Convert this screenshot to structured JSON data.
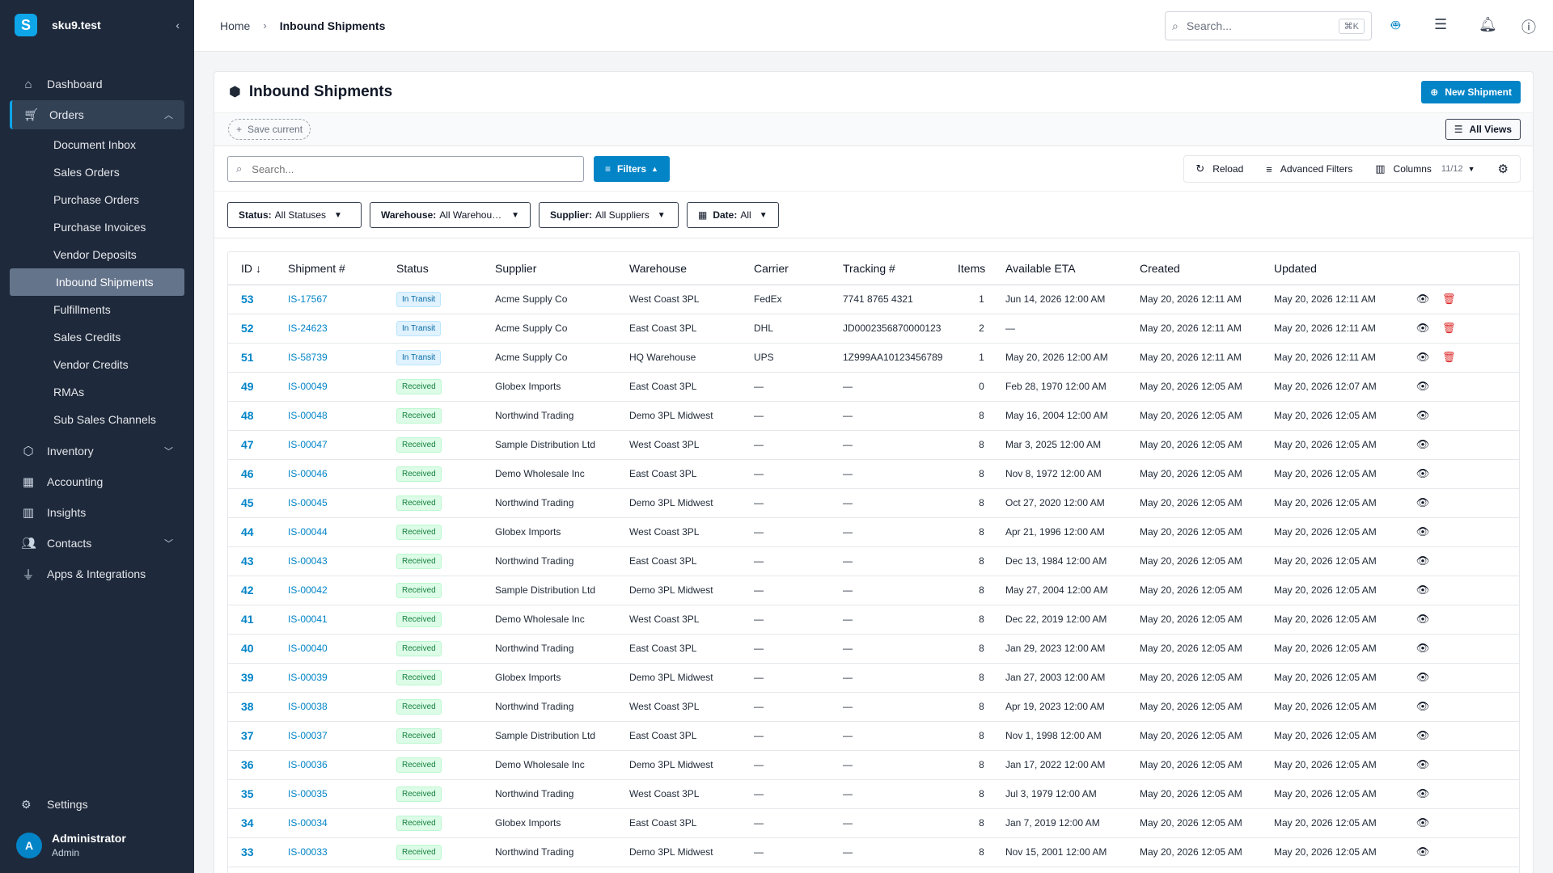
{
  "app": {
    "name": "sku9.test",
    "logo_letter": "S",
    "accent": "#0284c7"
  },
  "sidebar": {
    "items": [
      {
        "key": "dashboard",
        "label": "Dashboard",
        "icon": "home-icon"
      },
      {
        "key": "orders",
        "label": "Orders",
        "icon": "cart-icon",
        "expanded": true,
        "children": [
          "Document Inbox",
          "Sales Orders",
          "Purchase Orders",
          "Purchase Invoices",
          "Vendor Deposits",
          "Inbound Shipments",
          "Fulfillments",
          "Sales Credits",
          "Vendor Credits",
          "RMAs",
          "Sub Sales Channels"
        ]
      },
      {
        "key": "inventory",
        "label": "Inventory",
        "icon": "box-icon",
        "has_children": true
      },
      {
        "key": "accounting",
        "label": "Accounting",
        "icon": "calculator-icon"
      },
      {
        "key": "insights",
        "label": "Insights",
        "icon": "bar-chart-icon"
      },
      {
        "key": "contacts",
        "label": "Contacts",
        "icon": "users-icon",
        "has_children": true
      },
      {
        "key": "apps",
        "label": "Apps & Integrations",
        "icon": "plug-icon"
      }
    ],
    "active_child": "Inbound Shipments",
    "settings_label": "Settings",
    "user": {
      "initial": "A",
      "name": "Administrator",
      "role": "Admin"
    }
  },
  "topbar": {
    "breadcrumb_home": "Home",
    "breadcrumb_current": "Inbound Shipments",
    "search_placeholder": "Search...",
    "search_shortcut": "⌘K"
  },
  "page": {
    "title": "Inbound Shipments",
    "new_button": "New Shipment",
    "save_current": "Save current",
    "all_views": "All Views",
    "search_placeholder": "Search...",
    "filters_button": "Filters",
    "reload": "Reload",
    "advanced_filters": "Advanced Filters",
    "columns_label": "Columns",
    "columns_count": "11/12"
  },
  "filters": [
    {
      "key": "Status:",
      "value": "All Statuses"
    },
    {
      "key": "Warehouse:",
      "value": "All Warehouses"
    },
    {
      "key": "Supplier:",
      "value": "All Suppliers"
    },
    {
      "key": "Date:",
      "value": "All"
    }
  ],
  "table": {
    "columns": [
      "ID",
      "Shipment #",
      "Status",
      "Supplier",
      "Warehouse",
      "Carrier",
      "Tracking #",
      "Items",
      "Available ETA",
      "Created",
      "Updated"
    ],
    "rows": [
      {
        "id": "53",
        "shipment": "IS-17567",
        "status": "In Transit",
        "supplier": "Acme Supply Co",
        "warehouse": "West Coast 3PL",
        "carrier": "FedEx",
        "tracking": "7741 8765 4321",
        "items": "1",
        "eta": "Jun 14, 2026 12:00 AM",
        "created": "May 20, 2026 12:11 AM",
        "updated": "May 20, 2026 12:11 AM",
        "deletable": true
      },
      {
        "id": "52",
        "shipment": "IS-24623",
        "status": "In Transit",
        "supplier": "Acme Supply Co",
        "warehouse": "East Coast 3PL",
        "carrier": "DHL",
        "tracking": "JD0002356870000123",
        "items": "2",
        "eta": "—",
        "created": "May 20, 2026 12:11 AM",
        "updated": "May 20, 2026 12:11 AM",
        "deletable": true
      },
      {
        "id": "51",
        "shipment": "IS-58739",
        "status": "In Transit",
        "supplier": "Acme Supply Co",
        "warehouse": "HQ Warehouse",
        "carrier": "UPS",
        "tracking": "1Z999AA10123456789",
        "items": "1",
        "eta": "May 20, 2026 12:00 AM",
        "created": "May 20, 2026 12:11 AM",
        "updated": "May 20, 2026 12:11 AM",
        "deletable": true
      },
      {
        "id": "49",
        "shipment": "IS-00049",
        "status": "Received",
        "supplier": "Globex Imports",
        "warehouse": "East Coast 3PL",
        "carrier": "—",
        "tracking": "—",
        "items": "0",
        "eta": "Feb 28, 1970 12:00 AM",
        "created": "May 20, 2026 12:05 AM",
        "updated": "May 20, 2026 12:07 AM",
        "deletable": false
      },
      {
        "id": "48",
        "shipment": "IS-00048",
        "status": "Received",
        "supplier": "Northwind Trading",
        "warehouse": "Demo 3PL Midwest",
        "carrier": "—",
        "tracking": "—",
        "items": "8",
        "eta": "May 16, 2004 12:00 AM",
        "created": "May 20, 2026 12:05 AM",
        "updated": "May 20, 2026 12:05 AM",
        "deletable": false
      },
      {
        "id": "47",
        "shipment": "IS-00047",
        "status": "Received",
        "supplier": "Sample Distribution Ltd",
        "warehouse": "West Coast 3PL",
        "carrier": "—",
        "tracking": "—",
        "items": "8",
        "eta": "Mar 3, 2025 12:00 AM",
        "created": "May 20, 2026 12:05 AM",
        "updated": "May 20, 2026 12:05 AM",
        "deletable": false
      },
      {
        "id": "46",
        "shipment": "IS-00046",
        "status": "Received",
        "supplier": "Demo Wholesale Inc",
        "warehouse": "East Coast 3PL",
        "carrier": "—",
        "tracking": "—",
        "items": "8",
        "eta": "Nov 8, 1972 12:00 AM",
        "created": "May 20, 2026 12:05 AM",
        "updated": "May 20, 2026 12:05 AM",
        "deletable": false
      },
      {
        "id": "45",
        "shipment": "IS-00045",
        "status": "Received",
        "supplier": "Northwind Trading",
        "warehouse": "Demo 3PL Midwest",
        "carrier": "—",
        "tracking": "—",
        "items": "8",
        "eta": "Oct 27, 2020 12:00 AM",
        "created": "May 20, 2026 12:05 AM",
        "updated": "May 20, 2026 12:05 AM",
        "deletable": false
      },
      {
        "id": "44",
        "shipment": "IS-00044",
        "status": "Received",
        "supplier": "Globex Imports",
        "warehouse": "West Coast 3PL",
        "carrier": "—",
        "tracking": "—",
        "items": "8",
        "eta": "Apr 21, 1996 12:00 AM",
        "created": "May 20, 2026 12:05 AM",
        "updated": "May 20, 2026 12:05 AM",
        "deletable": false
      },
      {
        "id": "43",
        "shipment": "IS-00043",
        "status": "Received",
        "supplier": "Northwind Trading",
        "warehouse": "East Coast 3PL",
        "carrier": "—",
        "tracking": "—",
        "items": "8",
        "eta": "Dec 13, 1984 12:00 AM",
        "created": "May 20, 2026 12:05 AM",
        "updated": "May 20, 2026 12:05 AM",
        "deletable": false
      },
      {
        "id": "42",
        "shipment": "IS-00042",
        "status": "Received",
        "supplier": "Sample Distribution Ltd",
        "warehouse": "Demo 3PL Midwest",
        "carrier": "—",
        "tracking": "—",
        "items": "8",
        "eta": "May 27, 2004 12:00 AM",
        "created": "May 20, 2026 12:05 AM",
        "updated": "May 20, 2026 12:05 AM",
        "deletable": false
      },
      {
        "id": "41",
        "shipment": "IS-00041",
        "status": "Received",
        "supplier": "Demo Wholesale Inc",
        "warehouse": "West Coast 3PL",
        "carrier": "—",
        "tracking": "—",
        "items": "8",
        "eta": "Dec 22, 2019 12:00 AM",
        "created": "May 20, 2026 12:05 AM",
        "updated": "May 20, 2026 12:05 AM",
        "deletable": false
      },
      {
        "id": "40",
        "shipment": "IS-00040",
        "status": "Received",
        "supplier": "Northwind Trading",
        "warehouse": "East Coast 3PL",
        "carrier": "—",
        "tracking": "—",
        "items": "8",
        "eta": "Jan 29, 2023 12:00 AM",
        "created": "May 20, 2026 12:05 AM",
        "updated": "May 20, 2026 12:05 AM",
        "deletable": false
      },
      {
        "id": "39",
        "shipment": "IS-00039",
        "status": "Received",
        "supplier": "Globex Imports",
        "warehouse": "Demo 3PL Midwest",
        "carrier": "—",
        "tracking": "—",
        "items": "8",
        "eta": "Jan 27, 2003 12:00 AM",
        "created": "May 20, 2026 12:05 AM",
        "updated": "May 20, 2026 12:05 AM",
        "deletable": false
      },
      {
        "id": "38",
        "shipment": "IS-00038",
        "status": "Received",
        "supplier": "Northwind Trading",
        "warehouse": "West Coast 3PL",
        "carrier": "—",
        "tracking": "—",
        "items": "8",
        "eta": "Apr 19, 2023 12:00 AM",
        "created": "May 20, 2026 12:05 AM",
        "updated": "May 20, 2026 12:05 AM",
        "deletable": false
      },
      {
        "id": "37",
        "shipment": "IS-00037",
        "status": "Received",
        "supplier": "Sample Distribution Ltd",
        "warehouse": "East Coast 3PL",
        "carrier": "—",
        "tracking": "—",
        "items": "8",
        "eta": "Nov 1, 1998 12:00 AM",
        "created": "May 20, 2026 12:05 AM",
        "updated": "May 20, 2026 12:05 AM",
        "deletable": false
      },
      {
        "id": "36",
        "shipment": "IS-00036",
        "status": "Received",
        "supplier": "Demo Wholesale Inc",
        "warehouse": "Demo 3PL Midwest",
        "carrier": "—",
        "tracking": "—",
        "items": "8",
        "eta": "Jan 17, 2022 12:00 AM",
        "created": "May 20, 2026 12:05 AM",
        "updated": "May 20, 2026 12:05 AM",
        "deletable": false
      },
      {
        "id": "35",
        "shipment": "IS-00035",
        "status": "Received",
        "supplier": "Northwind Trading",
        "warehouse": "West Coast 3PL",
        "carrier": "—",
        "tracking": "—",
        "items": "8",
        "eta": "Jul 3, 1979 12:00 AM",
        "created": "May 20, 2026 12:05 AM",
        "updated": "May 20, 2026 12:05 AM",
        "deletable": false
      },
      {
        "id": "34",
        "shipment": "IS-00034",
        "status": "Received",
        "supplier": "Globex Imports",
        "warehouse": "East Coast 3PL",
        "carrier": "—",
        "tracking": "—",
        "items": "8",
        "eta": "Jan 7, 2019 12:00 AM",
        "created": "May 20, 2026 12:05 AM",
        "updated": "May 20, 2026 12:05 AM",
        "deletable": false
      },
      {
        "id": "33",
        "shipment": "IS-00033",
        "status": "Received",
        "supplier": "Northwind Trading",
        "warehouse": "Demo 3PL Midwest",
        "carrier": "—",
        "tracking": "—",
        "items": "8",
        "eta": "Nov 15, 2001 12:00 AM",
        "created": "May 20, 2026 12:05 AM",
        "updated": "May 20, 2026 12:05 AM",
        "deletable": false
      }
    ]
  }
}
